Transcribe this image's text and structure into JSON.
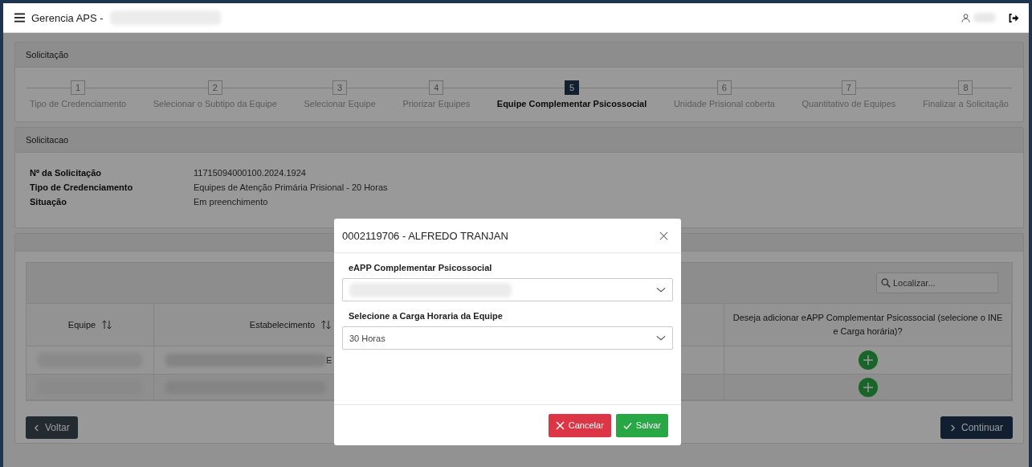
{
  "header": {
    "title": "Gerencia APS -"
  },
  "steps_panel": {
    "title": "Solicitação",
    "steps": [
      {
        "number": "1",
        "label": "Tipo de Credenciamento",
        "selected": false
      },
      {
        "number": "2",
        "label": "Selecionar o Subtipo da Equipe",
        "selected": false
      },
      {
        "number": "3",
        "label": "Selecionar Equipe",
        "selected": false
      },
      {
        "number": "4",
        "label": "Priorizar Equipes",
        "selected": false
      },
      {
        "number": "5",
        "label": "Equipe Complementar Psicossocial",
        "selected": true
      },
      {
        "number": "6",
        "label": "Unidade Prisional coberta",
        "selected": false
      },
      {
        "number": "7",
        "label": "Quantitativo de Equipes",
        "selected": false
      },
      {
        "number": "8",
        "label": "Finalizar a Solicitação",
        "selected": false
      }
    ]
  },
  "details_panel": {
    "title": "Solicitacao",
    "fields": [
      {
        "label": "Nº da Solicitação",
        "value": "11715094000100.2024.1924"
      },
      {
        "label": "Tipo de Credenciamento",
        "value": "Equipes de Atenção Primária Prisional - 20 Horas"
      },
      {
        "label": "Situação",
        "value": "Em preenchimento"
      }
    ]
  },
  "table": {
    "search": {
      "placeholder": "Localizar..."
    },
    "columns": [
      {
        "label": "Equipe",
        "sortable": true
      },
      {
        "label": "Estabelecimento",
        "sortable": true
      },
      {
        "label": "Deseja adicionar eAPP Complementar Psicossocial (selecione o INE e Carga horária)?",
        "sortable": false
      }
    ],
    "rows": [
      {
        "kind": "partial",
        "column_2": "E"
      },
      {
        "kind": "blurred"
      }
    ]
  },
  "footer_buttons": [
    {
      "label": "Voltar",
      "kind": "back"
    },
    {
      "label": "Continuar",
      "kind": "next"
    }
  ],
  "modal": {
    "title": "0002119706 - ALFREDO TRANJAN",
    "fields": [
      {
        "label": "eAPP Complementar Psicossocial",
        "kind": "blurred"
      },
      {
        "label": "Selecione a Carga Horaria da Equipe",
        "kind": "value",
        "value": "30 Horas"
      }
    ],
    "buttons": [
      {
        "label": "Cancelar",
        "kind": "cancel"
      },
      {
        "label": "Salvar",
        "kind": "save"
      }
    ]
  }
}
